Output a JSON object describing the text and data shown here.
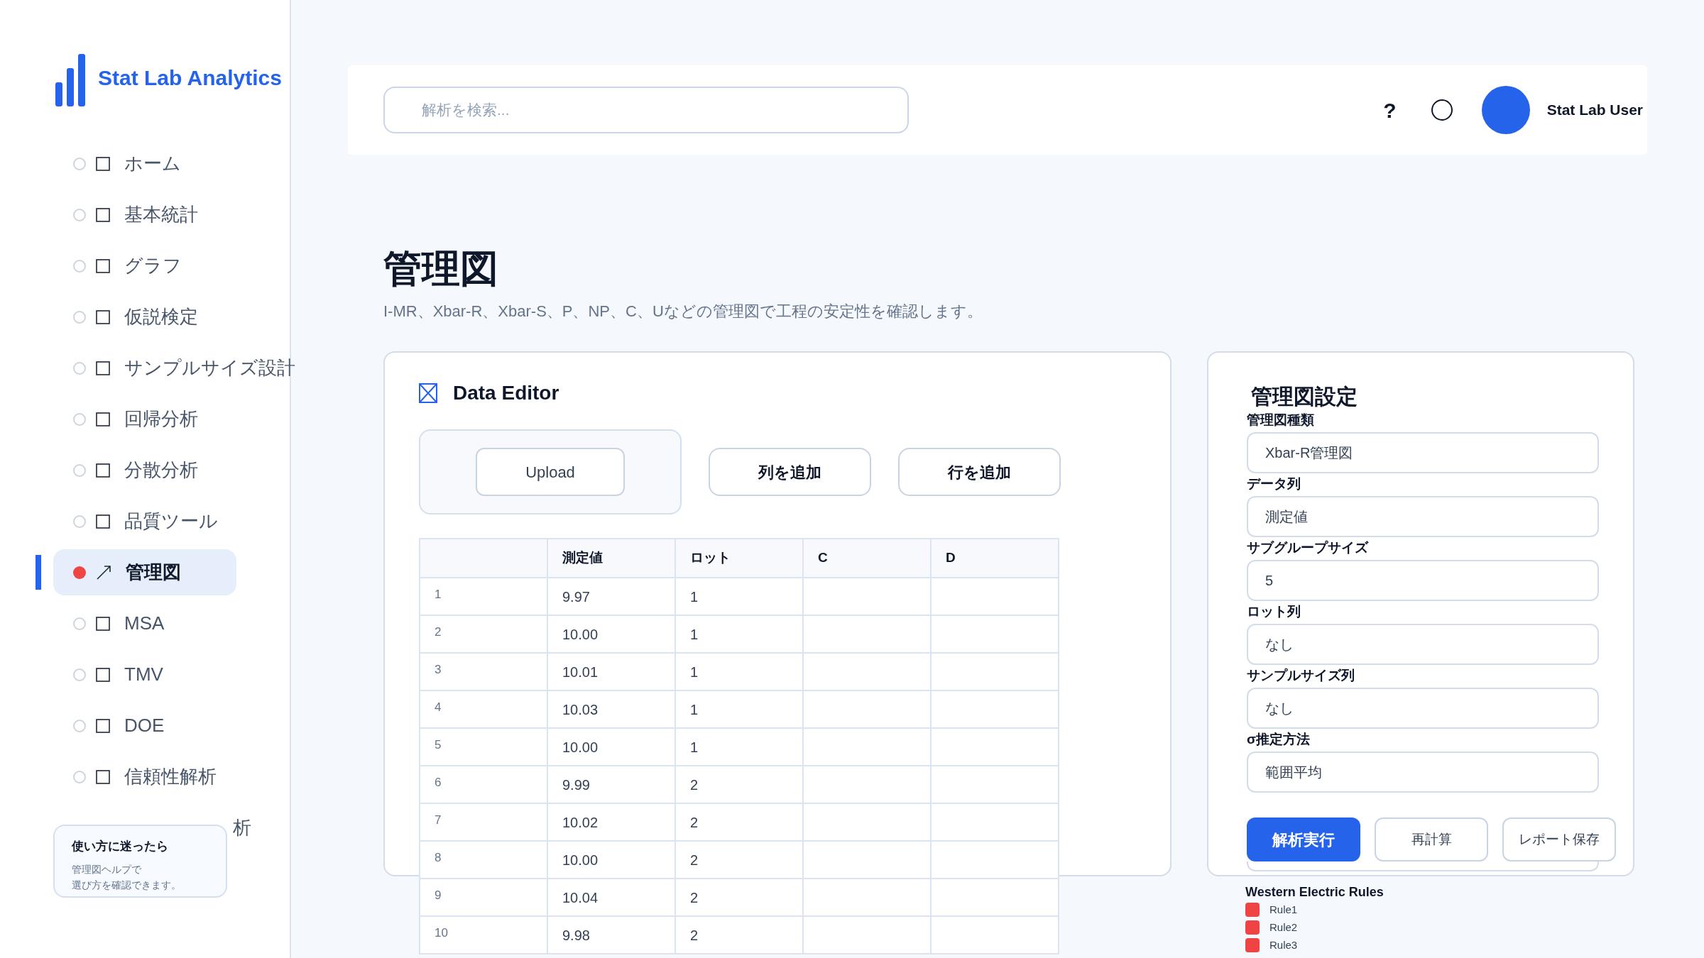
{
  "sidebar": {
    "brand": "Stat Lab Analytics",
    "nav": [
      {
        "label": "ホーム",
        "selected": false,
        "kind": "item"
      },
      {
        "label": "基本統計",
        "selected": false,
        "kind": "item"
      },
      {
        "label": "グラフ",
        "selected": false,
        "kind": "item"
      },
      {
        "label": "仮説検定",
        "selected": false,
        "kind": "item"
      },
      {
        "label": "サンプルサイズ設計",
        "selected": false,
        "kind": "item"
      },
      {
        "label": "回帰分析",
        "selected": false,
        "kind": "item"
      },
      {
        "label": "分散分析",
        "selected": false,
        "kind": "item"
      },
      {
        "label": "品質ツール",
        "selected": false,
        "kind": "item"
      },
      {
        "label": "管理図",
        "selected": true,
        "kind": "item"
      },
      {
        "label": "MSA",
        "selected": false,
        "kind": "item"
      },
      {
        "label": "TMV",
        "selected": false,
        "kind": "item"
      },
      {
        "label": "DOE",
        "selected": false,
        "kind": "item"
      },
      {
        "label": "信頼性解析",
        "selected": false,
        "kind": "item"
      },
      {
        "label": "析",
        "selected": false,
        "kind": "covered"
      }
    ],
    "help": {
      "title": "使い方に迷ったら",
      "lines": [
        "管理図ヘルプで",
        "選び方を確認できます。"
      ]
    }
  },
  "header": {
    "search": {
      "placeholder": "解析を検索..."
    },
    "help_icon": "?",
    "user": "Stat Lab User"
  },
  "page": {
    "title": "管理図",
    "subtitle": "I-MR、Xbar-R、Xbar-S、P、NP、C、Uなどの管理図で工程の安定性を確認します。"
  },
  "data_editor": {
    "title": "Data Editor",
    "buttons": [
      {
        "label": "Upload",
        "kind": "upload"
      },
      {
        "label": "列を追加",
        "kind": "action"
      },
      {
        "label": "行を追加",
        "kind": "action"
      }
    ],
    "columns": [
      "測定値",
      "ロット",
      "C",
      "D"
    ],
    "rows": [
      {
        "index": "1",
        "values": [
          "9.97",
          "1"
        ]
      },
      {
        "index": "2",
        "values": [
          "10.00",
          "1"
        ]
      },
      {
        "index": "3",
        "values": [
          "10.01",
          "1"
        ]
      },
      {
        "index": "4",
        "values": [
          "10.03",
          "1"
        ]
      },
      {
        "index": "5",
        "values": [
          "10.00",
          "1"
        ]
      },
      {
        "index": "6",
        "values": [
          "9.99",
          "2"
        ]
      },
      {
        "index": "7",
        "values": [
          "10.02",
          "2"
        ]
      },
      {
        "index": "8",
        "values": [
          "10.00",
          "2"
        ]
      },
      {
        "index": "9",
        "values": [
          "10.04",
          "2"
        ]
      },
      {
        "index": "10",
        "values": [
          "9.98",
          "2"
        ]
      }
    ]
  },
  "settings": {
    "title": "管理図設定",
    "fields": [
      {
        "label": "管理図種類",
        "value": "Xbar-R管理図"
      },
      {
        "label": "データ列",
        "value": "測定値"
      },
      {
        "label": "サブグループサイズ",
        "value": "5"
      },
      {
        "label": "ロット列",
        "value": "なし"
      },
      {
        "label": "サンプルサイズ列",
        "value": "なし"
      },
      {
        "label": "σ推定方法",
        "value": "範囲平均"
      }
    ],
    "buttons": [
      {
        "label": "解析実行",
        "kind": "primary"
      },
      {
        "label": "再計算",
        "kind": "secondary"
      },
      {
        "label": "レポート保存",
        "kind": "secondary"
      }
    ],
    "rules_title": "Western Electric Rules",
    "rules": [
      {
        "label": "Rule1",
        "color": "#ef4444"
      },
      {
        "label": "Rule2",
        "color": "#ef4444"
      },
      {
        "label": "Rule3",
        "color": "#ef4444"
      }
    ]
  }
}
